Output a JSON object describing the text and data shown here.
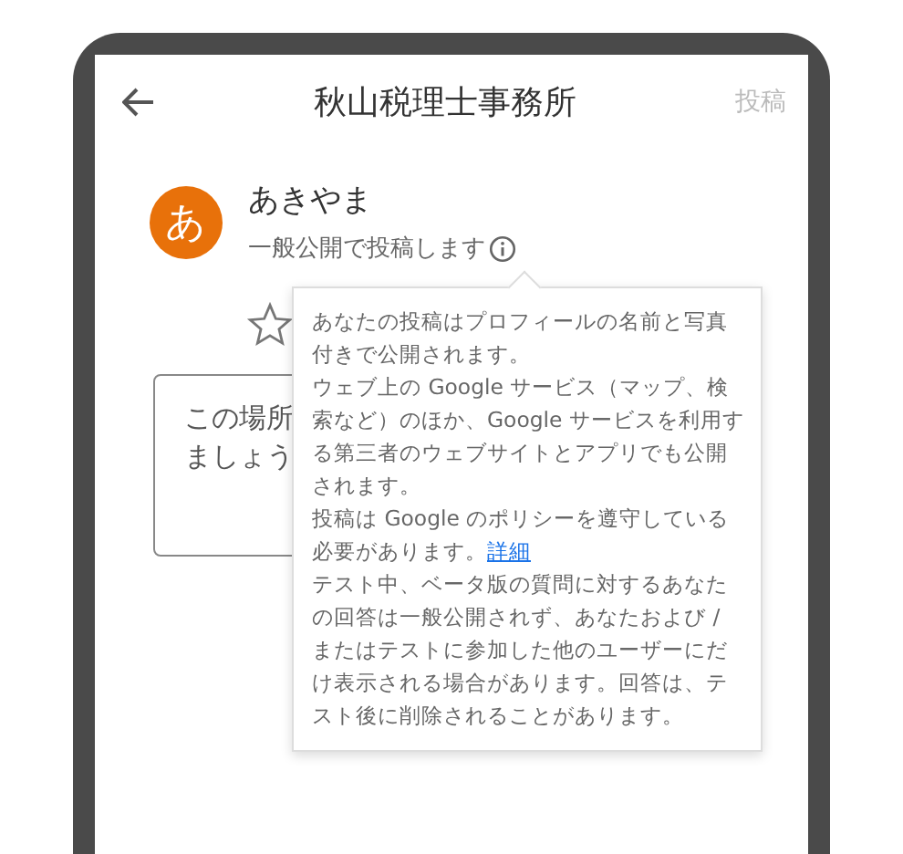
{
  "header": {
    "title": "秋山税理士事務所",
    "post_button": {
      "label": "投稿",
      "disabled": true
    }
  },
  "author": {
    "avatar_letter": "あ",
    "name": "あきやま",
    "visibility": "一般公開で投稿します"
  },
  "review_field": {
    "placeholder_lines": [
      "この場所",
      "ましょう"
    ]
  },
  "tooltip": {
    "paragraphs": [
      {
        "text": "あなたの投稿はプロフィールの名前と写真付きで公開されます。"
      },
      {
        "text": "ウェブ上の Google サービス（マップ、検索など）のほか、Google サービスを利用する第三者のウェブサイトとアプリでも公開されます。"
      },
      {
        "text": "投稿は Google のポリシーを遵守している必要があります。",
        "link": "詳細"
      },
      {
        "text": "テスト中、ベータ版の質問に対するあなたの回答は一般公開されず、あなたおよび / またはテストに参加した他のユーザーにだけ表示される場合があります。回答は、テスト後に削除されることがあります。"
      }
    ]
  }
}
